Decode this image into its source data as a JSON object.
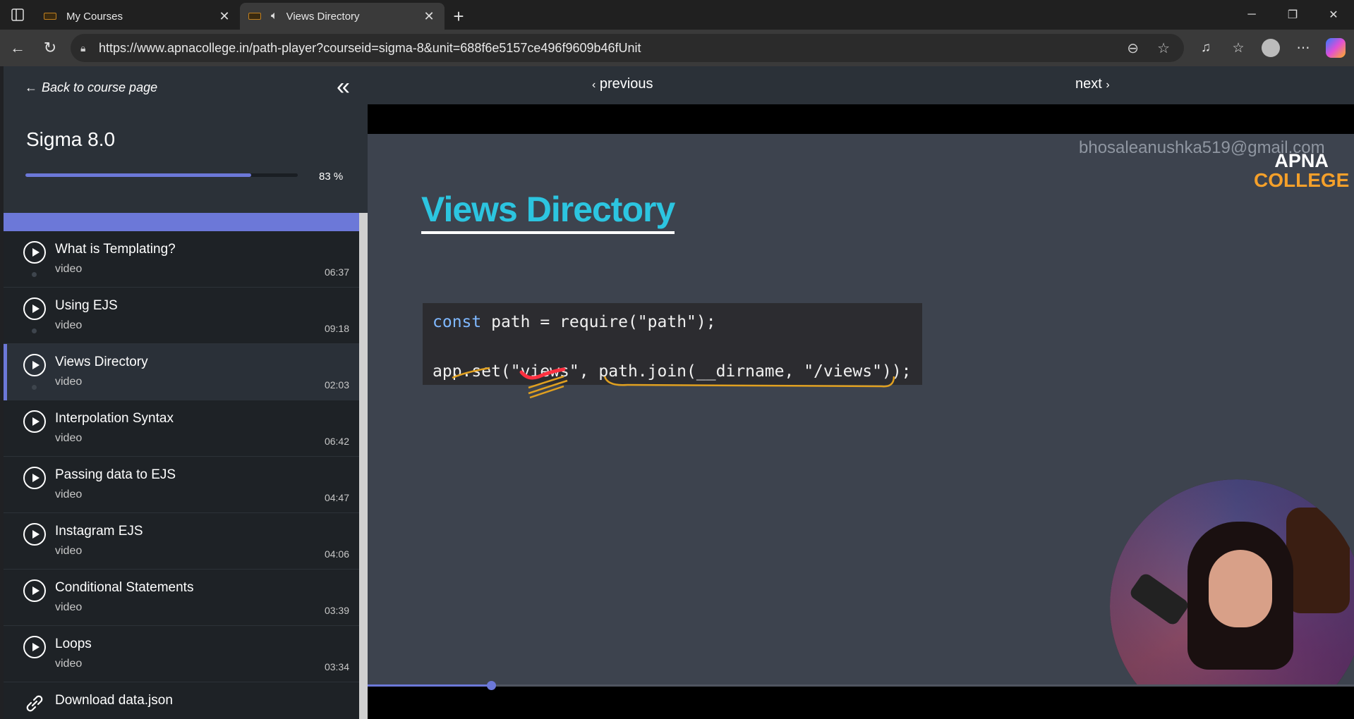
{
  "browser": {
    "tabs": [
      {
        "title": "My Courses",
        "active": false
      },
      {
        "title": "Views Directory",
        "active": true
      }
    ],
    "url": "https://www.apnacollege.in/path-player?courseid=sigma-8&unit=688f6e5157ce496f9609b46fUnit"
  },
  "sidebar": {
    "back_label": "Back to course page",
    "course_title": "Sigma 8.0",
    "progress_percent": 83,
    "progress_text": "83 %",
    "lessons": [
      {
        "title": "What is Templating?",
        "type": "video",
        "duration": "06:37",
        "active": false
      },
      {
        "title": "Using EJS",
        "type": "video",
        "duration": "09:18",
        "active": false
      },
      {
        "title": "Views Directory",
        "type": "video",
        "duration": "02:03",
        "active": true
      },
      {
        "title": "Interpolation Syntax",
        "type": "video",
        "duration": "06:42",
        "active": false
      },
      {
        "title": "Passing data to EJS",
        "type": "video",
        "duration": "04:47",
        "active": false
      },
      {
        "title": "Instagram EJS",
        "type": "video",
        "duration": "04:06",
        "active": false
      },
      {
        "title": "Conditional Statements",
        "type": "video",
        "duration": "03:39",
        "active": false
      },
      {
        "title": "Loops",
        "type": "video",
        "duration": "03:34",
        "active": false
      }
    ],
    "download_label": "Download data.json"
  },
  "player": {
    "previous_label": "previous",
    "next_label": "next",
    "watermark": "bhosaleanushka519@gmail.com",
    "logo_line1": "APNA",
    "logo_line2": "COLLEGE",
    "slide_title": "Views Directory",
    "code_line1_kw": "const",
    "code_line1_rest": " path = require(\"path\");",
    "code_line2": "app.set(\"views\", path.join(__dirname, \"/views\"));",
    "seek_progress": 0.125
  },
  "colors": {
    "accent": "#6c78d8",
    "slide_title": "#2cc5e0",
    "logo_orange": "#f5a02a"
  }
}
